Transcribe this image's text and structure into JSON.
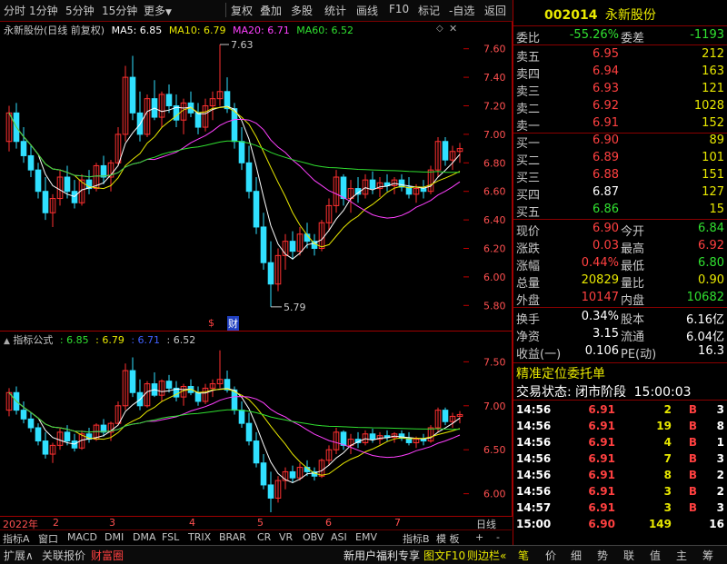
{
  "toolbar": {
    "items": [
      "分时",
      "1分钟",
      "5分钟",
      "15分钟",
      "更多",
      "复权",
      "叠加",
      "多股",
      "统计",
      "画线",
      "F10",
      "标记",
      "-自选",
      "返回"
    ]
  },
  "stock": {
    "code": "002014",
    "name": "永新股份"
  },
  "main_chart": {
    "title": "永新股份(日线 前复权)",
    "ma": [
      {
        "label": "MA5: 6.85",
        "color": "#ffffff"
      },
      {
        "label": "MA10: 6.79",
        "color": "#e8e800"
      },
      {
        "label": "MA20: 6.71",
        "color": "#ff40ff"
      },
      {
        "label": "MA60: 6.52",
        "color": "#30e030"
      }
    ],
    "high_marker": "7.63",
    "low_marker": "5.79",
    "yaxis": [
      "7.60",
      "7.40",
      "7.20",
      "7.00",
      "6.80",
      "6.60",
      "6.40",
      "6.20",
      "6.00",
      "5.80"
    ],
    "event_marks": [
      "$",
      "财"
    ]
  },
  "sub_chart": {
    "title": "指标公式",
    "values": [
      {
        "label": ": 6.85",
        "color": "#30e030"
      },
      {
        "label": ": 6.79",
        "color": "#e8e800"
      },
      {
        "label": ": 6.71",
        "color": "#4060ff"
      },
      {
        "label": ": 6.52",
        "color": "#c8c8c8"
      }
    ],
    "yaxis": [
      "7.50",
      "7.00",
      "6.50",
      "6.00"
    ]
  },
  "timeline": {
    "year": "2022年",
    "months": [
      "2",
      "3",
      "4",
      "5",
      "6",
      "7"
    ],
    "period": "日线"
  },
  "tabs": [
    "指标A",
    "窗口",
    "MACD",
    "DMI",
    "DMA",
    "FSL",
    "TRIX",
    "BRAR",
    "CR",
    "VR",
    "OBV",
    "ASI",
    "EMV",
    "指标B",
    "模 板",
    "+",
    "-"
  ],
  "status_bar": {
    "left": [
      "扩展∧",
      "关联报价",
      "财富圈"
    ],
    "middle": [
      "新用户福利专享",
      "图文F10",
      "则边栏«"
    ],
    "right": [
      "笔",
      "价",
      "细",
      "势",
      "联",
      "值",
      "主",
      "筹"
    ]
  },
  "quote": {
    "weibi_label": "委比",
    "weibi": "-55.26%",
    "weicha_label": "委差",
    "weicha": "-1193",
    "sell": [
      {
        "label": "卖五",
        "price": "6.95",
        "vol": "212"
      },
      {
        "label": "卖四",
        "price": "6.94",
        "vol": "163"
      },
      {
        "label": "卖三",
        "price": "6.93",
        "vol": "121"
      },
      {
        "label": "卖二",
        "price": "6.92",
        "vol": "1028"
      },
      {
        "label": "卖一",
        "price": "6.91",
        "vol": "152"
      }
    ],
    "buy": [
      {
        "label": "买一",
        "price": "6.90",
        "vol": "89"
      },
      {
        "label": "买二",
        "price": "6.89",
        "vol": "101"
      },
      {
        "label": "买三",
        "price": "6.88",
        "vol": "151"
      },
      {
        "label": "买四",
        "price": "6.87",
        "vol": "127"
      },
      {
        "label": "买五",
        "price": "6.86",
        "vol": "15"
      }
    ],
    "stats": [
      {
        "l1": "现价",
        "v1": "6.90",
        "c1": "red",
        "l2": "今开",
        "v2": "6.84",
        "c2": "green"
      },
      {
        "l1": "涨跌",
        "v1": "0.03",
        "c1": "red",
        "l2": "最高",
        "v2": "6.92",
        "c2": "red"
      },
      {
        "l1": "涨幅",
        "v1": "0.44%",
        "c1": "red",
        "l2": "最低",
        "v2": "6.80",
        "c2": "green"
      },
      {
        "l1": "总量",
        "v1": "20829",
        "c1": "yellow",
        "l2": "量比",
        "v2": "0.90",
        "c2": "yellow"
      },
      {
        "l1": "外盘",
        "v1": "10147",
        "c1": "red",
        "l2": "内盘",
        "v2": "10682",
        "c2": "green"
      }
    ],
    "stats2": [
      {
        "l1": "换手",
        "v1": "0.34%",
        "l2": "股本",
        "v2": "6.16亿"
      },
      {
        "l1": "净资",
        "v1": "3.15",
        "l2": "流通",
        "v2": "6.04亿"
      },
      {
        "l1": "收益(一)",
        "v1": "0.106",
        "l2": "PE(动)",
        "v2": "16.3"
      }
    ],
    "entrust_title": "精准定位委托单",
    "trade_status_label": "交易状态:",
    "trade_status": "闭市阶段",
    "trade_time": "15:00:03"
  },
  "ticks": [
    {
      "time": "14:56",
      "price": "6.91",
      "vol": "2",
      "side": "B",
      "n": "3"
    },
    {
      "time": "14:56",
      "price": "6.91",
      "vol": "19",
      "side": "B",
      "n": "8"
    },
    {
      "time": "14:56",
      "price": "6.91",
      "vol": "4",
      "side": "B",
      "n": "1"
    },
    {
      "time": "14:56",
      "price": "6.91",
      "vol": "7",
      "side": "B",
      "n": "3"
    },
    {
      "time": "14:56",
      "price": "6.91",
      "vol": "8",
      "side": "B",
      "n": "2"
    },
    {
      "time": "14:56",
      "price": "6.91",
      "vol": "3",
      "side": "B",
      "n": "2"
    },
    {
      "time": "14:57",
      "price": "6.91",
      "vol": "3",
      "side": "B",
      "n": "3"
    },
    {
      "time": "15:00",
      "price": "6.90",
      "vol": "149",
      "side": "",
      "n": "16"
    }
  ],
  "chart_data": {
    "type": "candlestick",
    "candles": [
      [
        6.95,
        7.2,
        6.88,
        7.15
      ],
      [
        7.15,
        7.22,
        6.9,
        6.95
      ],
      [
        6.95,
        7.05,
        6.8,
        6.85
      ],
      [
        6.85,
        6.92,
        6.7,
        6.75
      ],
      [
        6.75,
        6.8,
        6.55,
        6.6
      ],
      [
        6.6,
        6.7,
        6.4,
        6.45
      ],
      [
        6.45,
        6.58,
        6.35,
        6.55
      ],
      [
        6.55,
        6.75,
        6.5,
        6.7
      ],
      [
        6.7,
        6.78,
        6.55,
        6.6
      ],
      [
        6.6,
        6.68,
        6.48,
        6.52
      ],
      [
        6.52,
        6.72,
        6.5,
        6.68
      ],
      [
        6.68,
        6.75,
        6.58,
        6.62
      ],
      [
        6.62,
        6.8,
        6.6,
        6.78
      ],
      [
        6.78,
        6.85,
        6.65,
        6.7
      ],
      [
        6.7,
        6.82,
        6.6,
        6.8
      ],
      [
        6.8,
        7.05,
        6.78,
        7.0
      ],
      [
        7.0,
        7.48,
        6.95,
        7.4
      ],
      [
        7.4,
        7.55,
        7.1,
        7.15
      ],
      [
        7.15,
        7.3,
        6.95,
        7.0
      ],
      [
        7.0,
        7.28,
        6.98,
        7.25
      ],
      [
        7.25,
        7.38,
        7.1,
        7.12
      ],
      [
        7.12,
        7.3,
        7.05,
        7.28
      ],
      [
        7.28,
        7.35,
        7.15,
        7.2
      ],
      [
        7.2,
        7.28,
        7.05,
        7.1
      ],
      [
        7.1,
        7.25,
        7.0,
        7.22
      ],
      [
        7.22,
        7.3,
        7.12,
        7.15
      ],
      [
        7.15,
        7.22,
        7.0,
        7.05
      ],
      [
        7.05,
        7.25,
        7.02,
        7.2
      ],
      [
        7.2,
        7.3,
        7.1,
        7.25
      ],
      [
        7.25,
        7.63,
        7.2,
        7.3
      ],
      [
        7.3,
        7.4,
        7.15,
        7.18
      ],
      [
        7.18,
        7.22,
        6.9,
        6.95
      ],
      [
        6.95,
        7.05,
        6.75,
        6.8
      ],
      [
        6.8,
        6.92,
        6.55,
        6.6
      ],
      [
        6.6,
        6.7,
        6.3,
        6.35
      ],
      [
        6.35,
        6.45,
        6.05,
        6.1
      ],
      [
        6.1,
        6.25,
        5.79,
        5.95
      ],
      [
        5.95,
        6.2,
        5.9,
        6.15
      ],
      [
        6.15,
        6.3,
        6.05,
        6.25
      ],
      [
        6.25,
        6.32,
        6.12,
        6.18
      ],
      [
        6.18,
        6.35,
        6.15,
        6.3
      ],
      [
        6.3,
        6.38,
        6.2,
        6.25
      ],
      [
        6.25,
        6.3,
        6.15,
        6.2
      ],
      [
        6.2,
        6.4,
        6.18,
        6.38
      ],
      [
        6.38,
        6.55,
        6.32,
        6.5
      ],
      [
        6.5,
        6.75,
        6.45,
        6.7
      ],
      [
        6.7,
        6.72,
        6.5,
        6.55
      ],
      [
        6.55,
        6.68,
        6.45,
        6.62
      ],
      [
        6.62,
        6.7,
        6.52,
        6.58
      ],
      [
        6.58,
        6.72,
        6.55,
        6.68
      ],
      [
        6.68,
        6.74,
        6.58,
        6.62
      ],
      [
        6.62,
        6.7,
        6.56,
        6.66
      ],
      [
        6.66,
        6.72,
        6.6,
        6.64
      ],
      [
        6.64,
        6.7,
        6.58,
        6.68
      ],
      [
        6.68,
        6.72,
        6.6,
        6.63
      ],
      [
        6.63,
        6.7,
        6.55,
        6.58
      ],
      [
        6.58,
        6.65,
        6.52,
        6.62
      ],
      [
        6.62,
        6.68,
        6.55,
        6.6
      ],
      [
        6.6,
        6.78,
        6.58,
        6.75
      ],
      [
        6.75,
        6.98,
        6.7,
        6.95
      ],
      [
        6.95,
        6.98,
        6.78,
        6.82
      ],
      [
        6.82,
        6.92,
        6.75,
        6.88
      ],
      [
        6.88,
        6.94,
        6.8,
        6.9
      ]
    ],
    "ylim": [
      5.7,
      7.7
    ]
  }
}
